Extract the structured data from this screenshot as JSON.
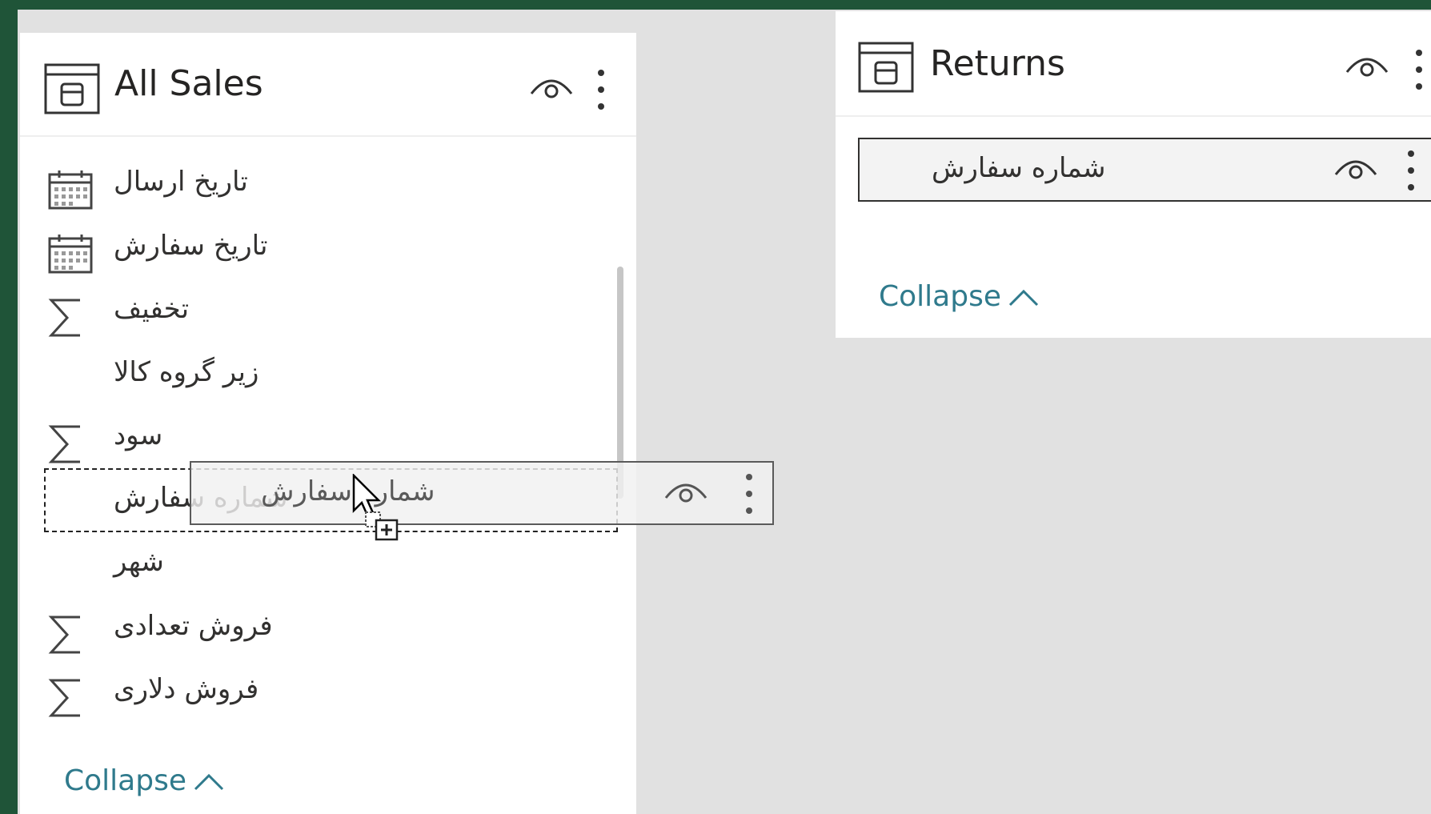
{
  "all_sales": {
    "title": "All Sales",
    "fields": [
      {
        "label": "تاریخ ارسال",
        "icon": "calendar-icon"
      },
      {
        "label": "تاریخ سفارش",
        "icon": "calendar-icon"
      },
      {
        "label": "تخفیف",
        "icon": "sigma-icon"
      },
      {
        "label": "زیر گروه کالا",
        "icon": ""
      },
      {
        "label": "سود",
        "icon": "sigma-icon"
      },
      {
        "label": "شماره سفارش",
        "icon": ""
      },
      {
        "label": "شهر",
        "icon": ""
      },
      {
        "label": "فروش تعدادی",
        "icon": "sigma-icon"
      },
      {
        "label": "فروش دلاری",
        "icon": "sigma-icon"
      }
    ],
    "collapse_label": "Collapse"
  },
  "returns": {
    "title": "Returns",
    "fields": [
      {
        "label": "شماره سفارش"
      }
    ],
    "collapse_label": "Collapse"
  },
  "drag": {
    "label": "شماره سفارش"
  },
  "colors": {
    "accent_link": "#2f7a8c",
    "frame": "#1f5438",
    "canvas": "#e1e1e1"
  }
}
